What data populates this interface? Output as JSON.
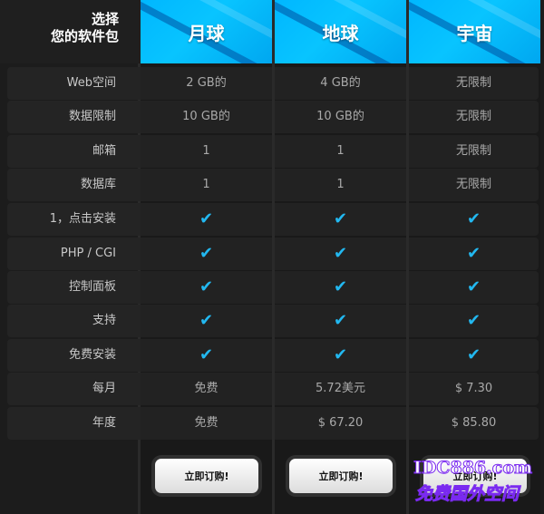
{
  "header": {
    "title_line1": "选择",
    "title_line2": "您的软件包",
    "plans": [
      "月球",
      "地球",
      "宇宙"
    ]
  },
  "rows": [
    {
      "label": "Web空间",
      "values": [
        "2 GB的",
        "4 GB的",
        "无限制"
      ]
    },
    {
      "label": "数据限制",
      "values": [
        "10 GB的",
        "10 GB的",
        "无限制"
      ]
    },
    {
      "label": "邮箱",
      "values": [
        "1",
        "1",
        "无限制"
      ]
    },
    {
      "label": "数据库",
      "values": [
        "1",
        "1",
        "无限制"
      ]
    },
    {
      "label": "1，点击安装",
      "values": [
        "✔",
        "✔",
        "✔"
      ]
    },
    {
      "label": "PHP / CGI",
      "values": [
        "✔",
        "✔",
        "✔"
      ]
    },
    {
      "label": "控制面板",
      "values": [
        "✔",
        "✔",
        "✔"
      ]
    },
    {
      "label": "支持",
      "values": [
        "✔",
        "✔",
        "✔"
      ]
    },
    {
      "label": "免费安装",
      "values": [
        "✔",
        "✔",
        "✔"
      ]
    },
    {
      "label": "每月",
      "values": [
        "免费",
        "5.72美元",
        "$ 7.30"
      ]
    },
    {
      "label": "年度",
      "values": [
        "免费",
        "$ 67.20",
        "$ 85.80"
      ]
    }
  ],
  "buttons": [
    "立即订购!",
    "立即订购!",
    "立即订购!"
  ],
  "watermark": {
    "line1": "IDC886.com",
    "line2": "免费国外空间"
  },
  "colors": {
    "accent": "#00b4ff",
    "check": "#22b8f0"
  }
}
